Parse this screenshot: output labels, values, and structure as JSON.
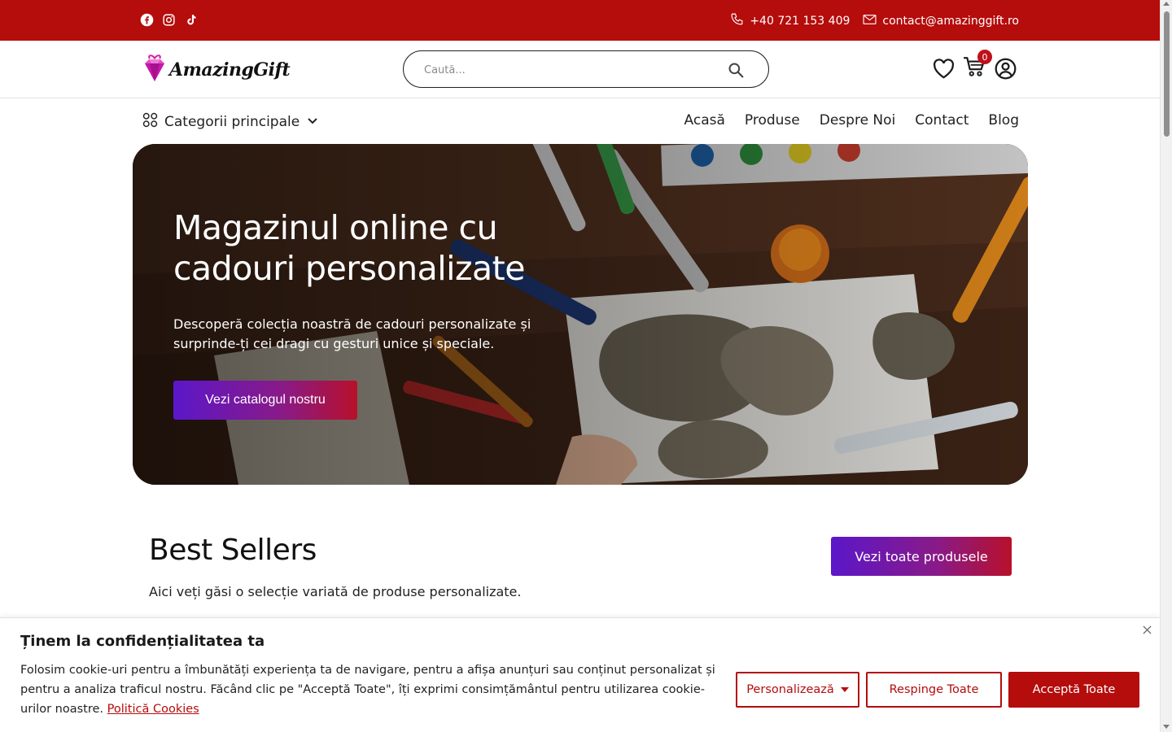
{
  "colors": {
    "brand_red": "#b50c0c",
    "gradient_start": "#5b17c9",
    "gradient_end": "#b8102a"
  },
  "topbar": {
    "social_icons": [
      "facebook-icon",
      "instagram-icon",
      "tiktok-icon"
    ],
    "phone": "+40 721 153 409",
    "email": "contact@amazinggift.ro"
  },
  "header": {
    "logo_text": "AmazingGift",
    "search_placeholder": "Caută...",
    "cart_count": "0",
    "icons": [
      "heart-icon",
      "cart-icon",
      "user-icon"
    ]
  },
  "nav": {
    "categories_label": "Categorii principale",
    "links": [
      "Acasă",
      "Produse",
      "Despre Noi",
      "Contact",
      "Blog"
    ]
  },
  "hero": {
    "title": "Magazinul online cu cadouri personalizate",
    "subtitle": "Descoperă colecția noastră de cadouri personalizate și surprinde-ți cei dragi cu gesturi unice și speciale.",
    "cta": "Vezi catalogul nostru"
  },
  "best_sellers": {
    "title": "Best Sellers",
    "subtitle": "Aici veți găsi o selecție variată de produse personalizate.",
    "button": "Vezi toate produsele"
  },
  "cookie": {
    "title": "Ținem la confidențialitatea ta",
    "text": "Folosim cookie-uri pentru a îmbunătăți experiența ta de navigare, pentru a afișa anunțuri sau conținut personalizat și pentru a analiza traficul nostru. Făcând clic pe \"Acceptă Toate\", îți exprimi consimțământul pentru utilizarea cookie-urilor noastre.",
    "link": "Politică Cookies",
    "customize": "Personalizează",
    "reject": "Respinge Toate",
    "accept": "Acceptă Toate"
  }
}
